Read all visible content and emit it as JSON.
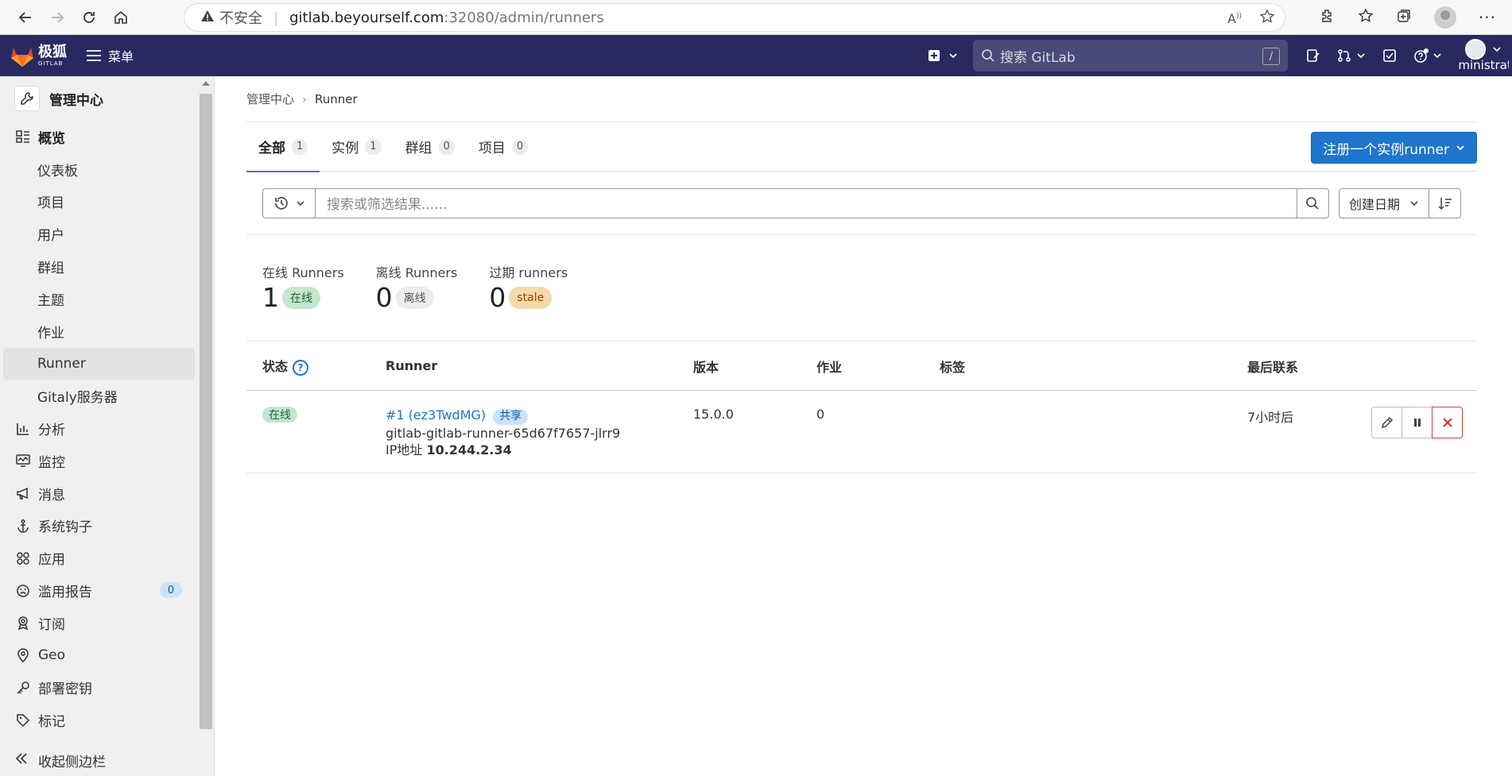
{
  "browser": {
    "security_label": "不安全",
    "url_host": "gitlab.beyourself.com",
    "url_path": ":32080/admin/runners"
  },
  "header": {
    "logo_text": "极狐",
    "logo_sub": "GITLAB",
    "menu_label": "菜单",
    "search_placeholder": "搜索 GitLab",
    "search_shortcut": "/",
    "user_name": "Administrator"
  },
  "sidebar": {
    "title": "管理中心",
    "items": [
      {
        "label": "概览",
        "icon": "overview-icon"
      },
      {
        "label": "仪表板"
      },
      {
        "label": "项目"
      },
      {
        "label": "用户"
      },
      {
        "label": "群组"
      },
      {
        "label": "主题"
      },
      {
        "label": "作业"
      },
      {
        "label": "Runner"
      },
      {
        "label": "Gitaly服务器"
      },
      {
        "label": "分析",
        "icon": "chart-icon"
      },
      {
        "label": "监控",
        "icon": "monitor-icon"
      },
      {
        "label": "消息",
        "icon": "megaphone-icon"
      },
      {
        "label": "系统钩子",
        "icon": "anchor-icon"
      },
      {
        "label": "应用",
        "icon": "apps-icon"
      },
      {
        "label": "滥用报告",
        "icon": "abuse-icon",
        "badge": "0"
      },
      {
        "label": "订阅",
        "icon": "subscription-icon"
      },
      {
        "label": "Geo",
        "icon": "geo-icon"
      },
      {
        "label": "部署密钥",
        "icon": "key-icon"
      },
      {
        "label": "标记",
        "icon": "label-icon"
      }
    ],
    "collapse_label": "收起侧边栏"
  },
  "breadcrumb": {
    "root": "管理中心",
    "current": "Runner"
  },
  "tabs": [
    {
      "label": "全部",
      "count": "1"
    },
    {
      "label": "实例",
      "count": "1"
    },
    {
      "label": "群组",
      "count": "0"
    },
    {
      "label": "项目",
      "count": "0"
    }
  ],
  "register_button": "注册一个实例runner",
  "filter": {
    "placeholder": "搜索或筛选结果......",
    "sort_label": "创建日期"
  },
  "stats": [
    {
      "label": "在线 Runners",
      "value": "1",
      "pill": "在线"
    },
    {
      "label": "离线 Runners",
      "value": "0",
      "pill": "离线"
    },
    {
      "label": "过期 runners",
      "value": "0",
      "pill": "stale"
    }
  ],
  "table": {
    "headers": {
      "status": "状态",
      "runner": "Runner",
      "version": "版本",
      "jobs": "作业",
      "tags": "标签",
      "last_contact": "最后联系"
    },
    "rows": [
      {
        "status": "在线",
        "runner_id": "#1 (ez3TwdMG)",
        "shared": "共享",
        "description": "gitlab-gitlab-runner-65d67f7657-jlrr9",
        "ip_label": "IP地址",
        "ip": "10.244.2.34",
        "version": "15.0.0",
        "jobs": "0",
        "tags": "",
        "last_contact": "7小时后"
      }
    ]
  },
  "colors": {
    "header_bg": "#292961",
    "primary": "#1f75cb",
    "online": "#c3e6cd",
    "stale": "#f5d9a8",
    "danger": "#d62f2f"
  }
}
